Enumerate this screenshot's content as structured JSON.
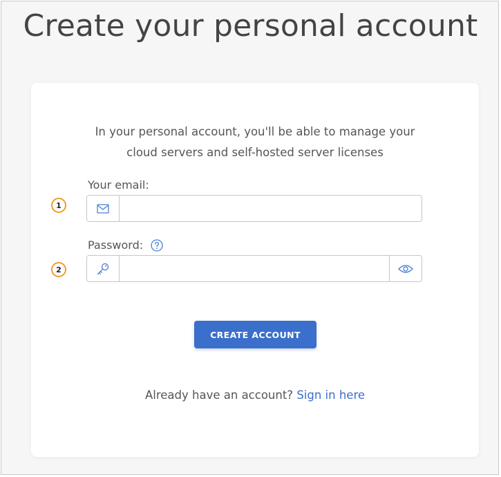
{
  "page": {
    "title": "Create your personal account"
  },
  "card": {
    "intro_line1": "In your personal account, you'll be able to manage your",
    "intro_line2": "cloud servers and self-hosted server licenses"
  },
  "email_field": {
    "label": "Your email:",
    "value": "",
    "icon": "envelope-icon"
  },
  "password_field": {
    "label": "Password:",
    "value": "",
    "icon": "key-icon",
    "help_icon": "question-circle-icon",
    "toggle_icon": "eye-icon"
  },
  "actions": {
    "create_label": "CREATE ACCOUNT"
  },
  "signin": {
    "prompt": "Already have an account?",
    "link_label": "Sign in here"
  },
  "annotations": {
    "step1": "1",
    "step2": "2"
  },
  "colors": {
    "accent": "#3a6fcc",
    "badge_border": "#f29a2e",
    "page_background": "#f6f6f6",
    "card_background": "#ffffff"
  }
}
